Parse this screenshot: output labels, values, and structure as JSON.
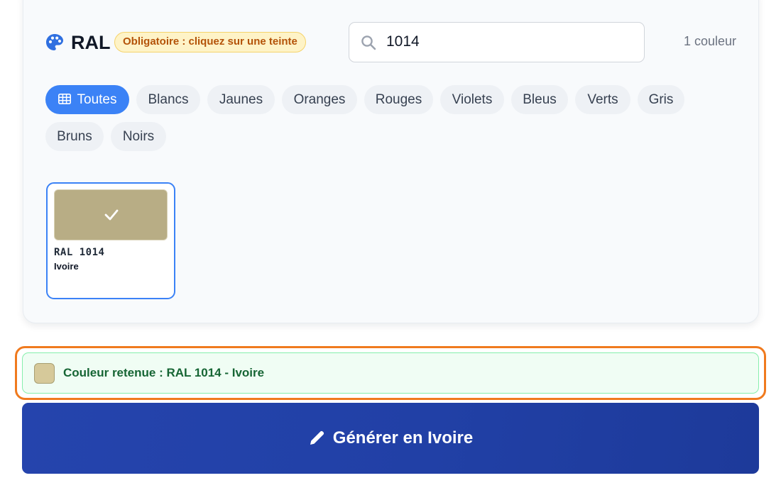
{
  "section": {
    "title": "RAL",
    "required_badge": "Obligatoire : cliquez sur une teinte",
    "count_label": "1 couleur"
  },
  "search": {
    "value": "1014",
    "icon": "search-icon"
  },
  "filters": [
    {
      "label": "Toutes",
      "active": true,
      "icon": "grid-icon"
    },
    {
      "label": "Blancs",
      "active": false
    },
    {
      "label": "Jaunes",
      "active": false
    },
    {
      "label": "Oranges",
      "active": false
    },
    {
      "label": "Rouges",
      "active": false
    },
    {
      "label": "Violets",
      "active": false
    },
    {
      "label": "Bleus",
      "active": false
    },
    {
      "label": "Verts",
      "active": false
    },
    {
      "label": "Gris",
      "active": false
    },
    {
      "label": "Bruns",
      "active": false
    },
    {
      "label": "Noirs",
      "active": false
    }
  ],
  "results": [
    {
      "code": "RAL 1014",
      "name": "Ivoire",
      "color": "#b8ad85",
      "selected": true
    }
  ],
  "selection": {
    "label": "Couleur retenue : RAL 1014 - Ivoire",
    "swatch_color": "#d6c99a"
  },
  "generate_button": {
    "label": "Générer en Ivoire",
    "icon": "pencil-icon"
  },
  "colors": {
    "accent": "#3b82f6",
    "highlight": "#f07a1e",
    "success_text": "#166534",
    "button_bg": "#2140a6"
  }
}
